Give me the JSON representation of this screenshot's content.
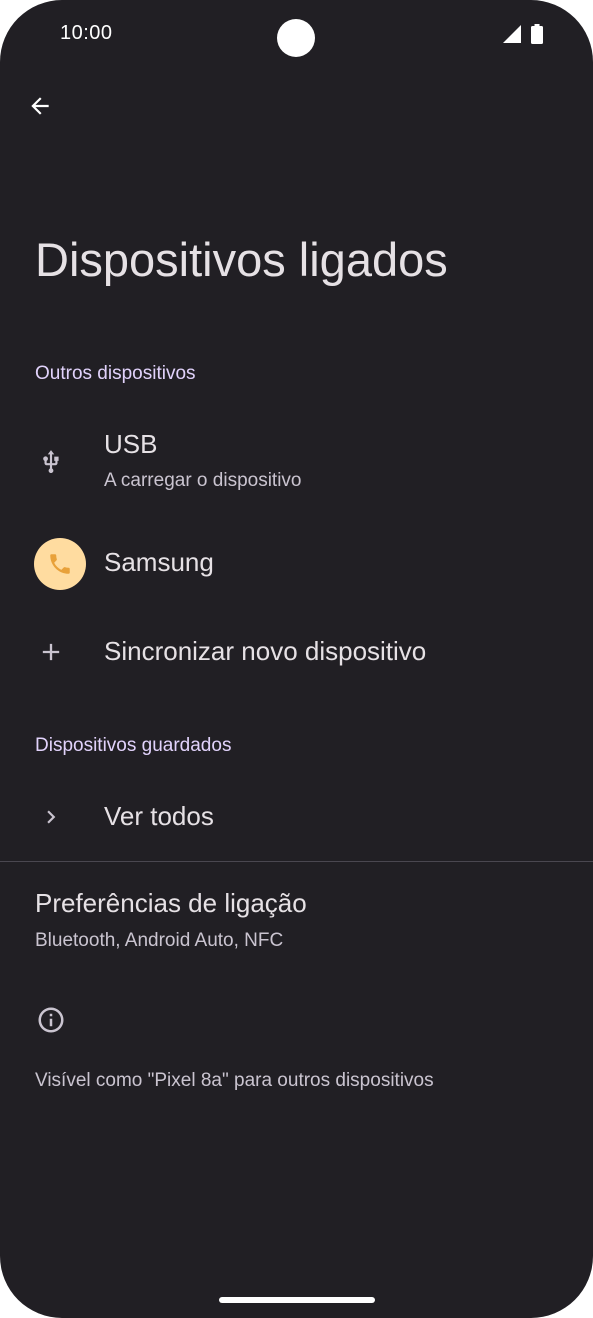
{
  "status_bar": {
    "time": "10:00",
    "icons": [
      "signal-icon",
      "battery-icon"
    ]
  },
  "header": {
    "back_icon": "arrow-back-icon",
    "title": "Dispositivos ligados"
  },
  "sections": {
    "other_devices": {
      "header": "Outros dispositivos",
      "usb": {
        "icon": "usb-icon",
        "label": "USB",
        "sublabel": "A carregar o dispositivo"
      },
      "samsung": {
        "icon": "phone-icon",
        "label": "Samsung"
      },
      "pair_new": {
        "icon": "plus-icon",
        "label": "Sincronizar novo dispositivo"
      }
    },
    "saved_devices": {
      "header": "Dispositivos guardados",
      "see_all": {
        "icon": "chevron-right-icon",
        "label": "Ver todos"
      }
    }
  },
  "connection_preferences": {
    "title": "Preferências de ligação",
    "subtitle": "Bluetooth, Android Auto, NFC"
  },
  "footer": {
    "info_icon": "info-icon",
    "visible_as": "Visível como \"Pixel 8a\" para outros dispositivos"
  },
  "colors": {
    "background": "#211f24",
    "accent_header": "#e1d2fb",
    "avatar_bg": "#ffdca0",
    "avatar_icon": "#7a4f00"
  }
}
